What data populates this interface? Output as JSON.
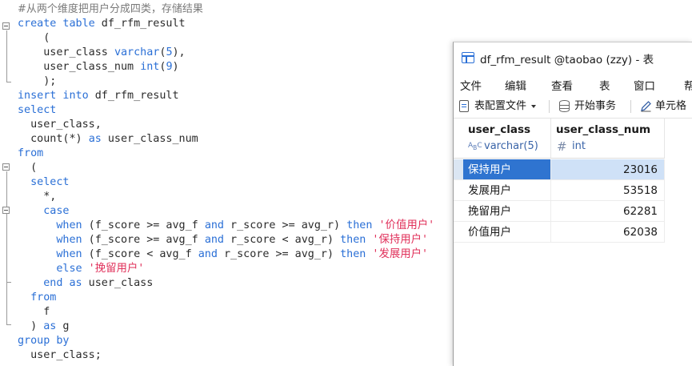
{
  "editor": {
    "lines": [
      {
        "parts": [
          {
            "t": "#从两个维度把用户分成四类，存储结果",
            "c": "cmt"
          }
        ]
      },
      {
        "parts": [
          {
            "t": "create table",
            "c": "kw"
          },
          {
            "t": " df_rfm_result",
            "c": ""
          }
        ]
      },
      {
        "parts": [
          {
            "t": "    (",
            "c": ""
          }
        ]
      },
      {
        "parts": [
          {
            "t": "    user_class ",
            "c": ""
          },
          {
            "t": "varchar",
            "c": "kw"
          },
          {
            "t": "(",
            "c": ""
          },
          {
            "t": "5",
            "c": "kw"
          },
          {
            "t": "),",
            "c": ""
          }
        ]
      },
      {
        "parts": [
          {
            "t": "    user_class_num ",
            "c": ""
          },
          {
            "t": "int",
            "c": "kw"
          },
          {
            "t": "(",
            "c": ""
          },
          {
            "t": "9",
            "c": "kw"
          },
          {
            "t": ")",
            "c": ""
          }
        ]
      },
      {
        "parts": [
          {
            "t": "    );",
            "c": ""
          }
        ]
      },
      {
        "parts": [
          {
            "t": "insert into",
            "c": "kw"
          },
          {
            "t": " df_rfm_result",
            "c": ""
          }
        ]
      },
      {
        "parts": [
          {
            "t": "select",
            "c": "kw"
          }
        ]
      },
      {
        "parts": [
          {
            "t": "  user_class,",
            "c": ""
          }
        ]
      },
      {
        "parts": [
          {
            "t": "  count(*) ",
            "c": ""
          },
          {
            "t": "as",
            "c": "kw"
          },
          {
            "t": " user_class_num",
            "c": ""
          }
        ]
      },
      {
        "parts": [
          {
            "t": "from",
            "c": "kw"
          }
        ]
      },
      {
        "parts": [
          {
            "t": "  (",
            "c": ""
          }
        ]
      },
      {
        "parts": [
          {
            "t": "  select",
            "c": "kw"
          }
        ]
      },
      {
        "parts": [
          {
            "t": "    *,",
            "c": ""
          }
        ]
      },
      {
        "parts": [
          {
            "t": "    case",
            "c": "kw"
          }
        ]
      },
      {
        "parts": [
          {
            "t": "      when",
            "c": "kw"
          },
          {
            "t": " (f_score >= avg_f ",
            "c": ""
          },
          {
            "t": "and",
            "c": "kw"
          },
          {
            "t": " r_score >= avg_r) ",
            "c": ""
          },
          {
            "t": "then",
            "c": "kw"
          },
          {
            "t": " '价值用户'",
            "c": "str"
          }
        ]
      },
      {
        "parts": [
          {
            "t": "      when",
            "c": "kw"
          },
          {
            "t": " (f_score >= avg_f ",
            "c": ""
          },
          {
            "t": "and",
            "c": "kw"
          },
          {
            "t": " r_score < avg_r) ",
            "c": ""
          },
          {
            "t": "then",
            "c": "kw"
          },
          {
            "t": " '保持用户'",
            "c": "str"
          }
        ]
      },
      {
        "parts": [
          {
            "t": "      when",
            "c": "kw"
          },
          {
            "t": " (f_score < avg_f ",
            "c": ""
          },
          {
            "t": "and",
            "c": "kw"
          },
          {
            "t": " r_score >= avg_r) ",
            "c": ""
          },
          {
            "t": "then",
            "c": "kw"
          },
          {
            "t": " '发展用户'",
            "c": "str"
          }
        ]
      },
      {
        "parts": [
          {
            "t": "      else",
            "c": "kw"
          },
          {
            "t": " '挽留用户'",
            "c": "str"
          }
        ]
      },
      {
        "parts": [
          {
            "t": "    end as",
            "c": "kw"
          },
          {
            "t": " user_class",
            "c": ""
          }
        ]
      },
      {
        "parts": [
          {
            "t": "  from",
            "c": "kw"
          }
        ]
      },
      {
        "parts": [
          {
            "t": "    f",
            "c": ""
          }
        ]
      },
      {
        "parts": [
          {
            "t": "  ) ",
            "c": ""
          },
          {
            "t": "as",
            "c": "kw"
          },
          {
            "t": " g",
            "c": ""
          }
        ]
      },
      {
        "parts": [
          {
            "t": "group by",
            "c": "kw"
          }
        ]
      },
      {
        "parts": [
          {
            "t": "  user_class;",
            "c": ""
          }
        ]
      }
    ]
  },
  "window": {
    "title": "df_rfm_result @taobao (zzy) - 表",
    "menu": [
      "文件",
      "编辑",
      "查看",
      "表",
      "窗口",
      "帮"
    ],
    "toolbar": {
      "table_config": "表配置文件",
      "begin_transaction": "开始事务",
      "cell_format": "单元格"
    },
    "columns": [
      {
        "name": "user_class",
        "type": "varchar(5)",
        "icon": "text-type-icon"
      },
      {
        "name": "user_class_num",
        "type": "int",
        "icon": "number-type-icon"
      }
    ],
    "rows": [
      {
        "user_class": "保持用户",
        "user_class_num": "23016"
      },
      {
        "user_class": "发展用户",
        "user_class_num": "53518"
      },
      {
        "user_class": "挽留用户",
        "user_class_num": "62281"
      },
      {
        "user_class": "价值用户",
        "user_class_num": "62038"
      }
    ],
    "selected_row": 0,
    "colors": {
      "keyword": "#2a6fd6",
      "string": "#e0305a",
      "selection": "#2f74d0"
    }
  }
}
